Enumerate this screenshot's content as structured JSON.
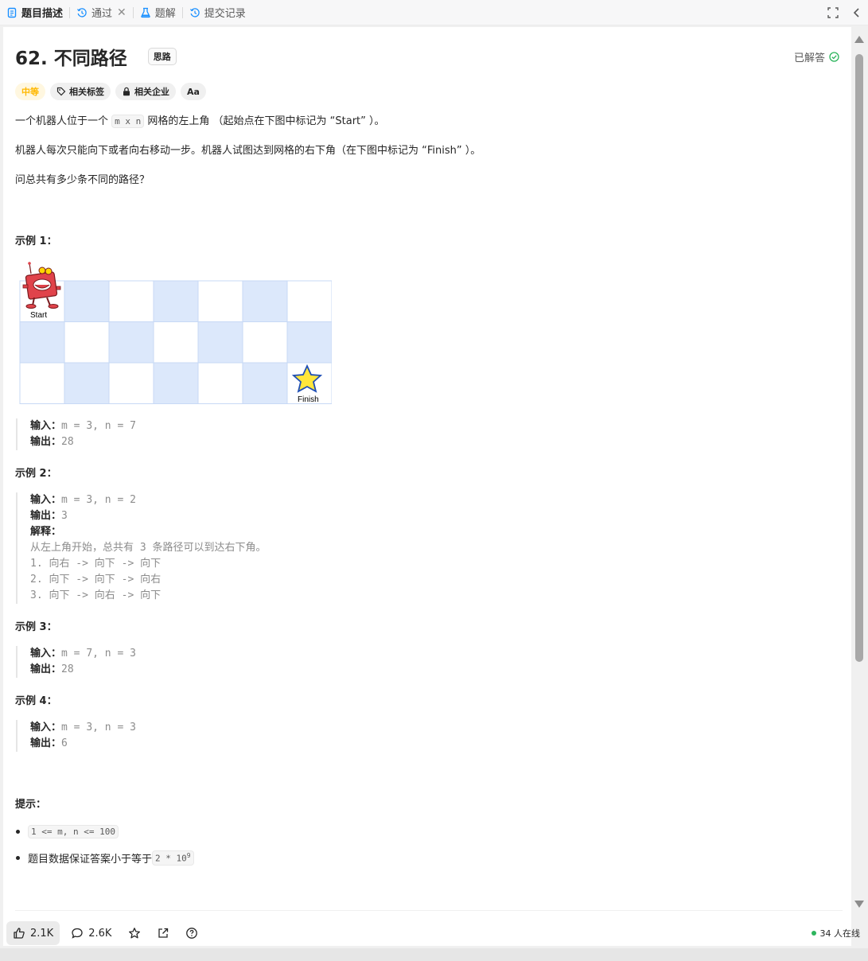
{
  "tabs": [
    {
      "label": "题目描述",
      "icon": "document-icon",
      "active": true
    },
    {
      "label": "通过",
      "icon": "history-icon",
      "closable": true
    },
    {
      "label": "题解",
      "icon": "flask-icon"
    },
    {
      "label": "提交记录",
      "icon": "history-icon"
    }
  ],
  "problem": {
    "title": "62. 不同路径",
    "hint_chip": "思路",
    "status": "已解答",
    "tags": {
      "difficulty": "中等",
      "related_tags": "相关标签",
      "companies": "相关企业",
      "font_toggle": "Aa"
    },
    "description": {
      "p1_before": "一个机器人位于一个 ",
      "p1_code": "m x n",
      "p1_after": " 网格的左上角 （起始点在下图中标记为 “Start” ）。",
      "p2": "机器人每次只能向下或者向右移动一步。机器人试图达到网格的右下角（在下图中标记为 “Finish” ）。",
      "p3": "问总共有多少条不同的路径？"
    },
    "grid": {
      "rows": 3,
      "cols": 7,
      "start_label": "Start",
      "finish_label": "Finish"
    },
    "examples": [
      {
        "heading": "示例 1：",
        "input_label": "输入：",
        "input": "m = 3, n = 7",
        "output_label": "输出：",
        "output": "28"
      },
      {
        "heading": "示例 2：",
        "input_label": "输入：",
        "input": "m = 3, n = 2",
        "output_label": "输出：",
        "output": "3",
        "explain_label": "解释：",
        "explain_lines": [
          "从左上角开始，总共有 3 条路径可以到达右下角。",
          "1. 向右 -> 向下 -> 向下",
          "2. 向下 -> 向下 -> 向右",
          "3. 向下 -> 向右 -> 向下"
        ]
      },
      {
        "heading": "示例 3：",
        "input_label": "输入：",
        "input": "m = 7, n = 3",
        "output_label": "输出：",
        "output": "28"
      },
      {
        "heading": "示例 4：",
        "input_label": "输入：",
        "input": "m = 3, n = 3",
        "output_label": "输出：",
        "output": "6"
      }
    ],
    "constraints_heading": "提示：",
    "constraints": {
      "c1_code": "1 <= m, n <= 100",
      "c2_text": "题目数据保证答案小于等于 ",
      "c2_code": "2 * 10",
      "c2_sup": "9"
    }
  },
  "footer": {
    "likes": "2.1K",
    "comments": "2.6K",
    "online": "34 人在线"
  },
  "colors": {
    "accent": "#1a90ff",
    "medium": "#ffb800",
    "grid_blue": "#dce8fb",
    "solved_green": "#2db55d"
  }
}
